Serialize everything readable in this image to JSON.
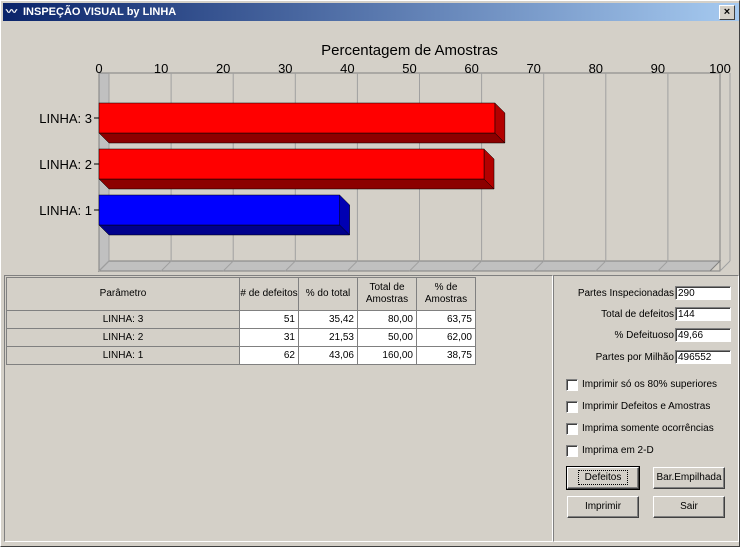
{
  "window": {
    "title": "INSPEÇÃO VISUAL by LINHA",
    "close_label": "×",
    "icon": "app-icon"
  },
  "chart_data": {
    "type": "bar",
    "orientation": "horizontal",
    "title": "Percentagem de Amostras",
    "categories": [
      "LINHA: 3",
      "LINHA: 2",
      "LINHA: 1"
    ],
    "values": [
      63.75,
      62.0,
      38.75
    ],
    "colors": [
      "#ff0000",
      "#ff0000",
      "#0000ff"
    ],
    "xlim": [
      0,
      100
    ],
    "ticks": [
      "0",
      "10",
      "20",
      "30",
      "40",
      "50",
      "60",
      "70",
      "80",
      "90",
      "100"
    ],
    "grid": true,
    "style": "3d"
  },
  "table": {
    "headers": [
      "Parâmetro",
      "# de defeitos",
      "% do total",
      "Total de Amostras",
      "% de Amostras"
    ],
    "rows": [
      [
        "LINHA: 3",
        "51",
        "35,42",
        "80,00",
        "63,75"
      ],
      [
        "LINHA: 2",
        "31",
        "21,53",
        "50,00",
        "62,00"
      ],
      [
        "LINHA: 1",
        "62",
        "43,06",
        "160,00",
        "38,75"
      ]
    ]
  },
  "summary": {
    "partes_inspecionadas": {
      "label": "Partes Inspecionadas",
      "value": "290"
    },
    "total_defeitos": {
      "label": "Total de defeitos",
      "value": "144"
    },
    "pct_defeituoso": {
      "label": "% Defeituoso",
      "value": "49,66"
    },
    "partes_milhao": {
      "label": "Partes por Milhão",
      "value": "496552"
    }
  },
  "options": [
    {
      "label": "Imprimir só os 80% superiores",
      "checked": false
    },
    {
      "label": "Imprimir Defeitos e Amostras",
      "checked": false
    },
    {
      "label": "Imprima somente ocorrências",
      "checked": false
    },
    {
      "label": "Imprima em 2-D",
      "checked": false
    }
  ],
  "buttons": {
    "defeitos": "Defeitos",
    "bar_empilhada": "Bar.Empilhada",
    "imprimir": "Imprimir",
    "sair": "Sair"
  }
}
